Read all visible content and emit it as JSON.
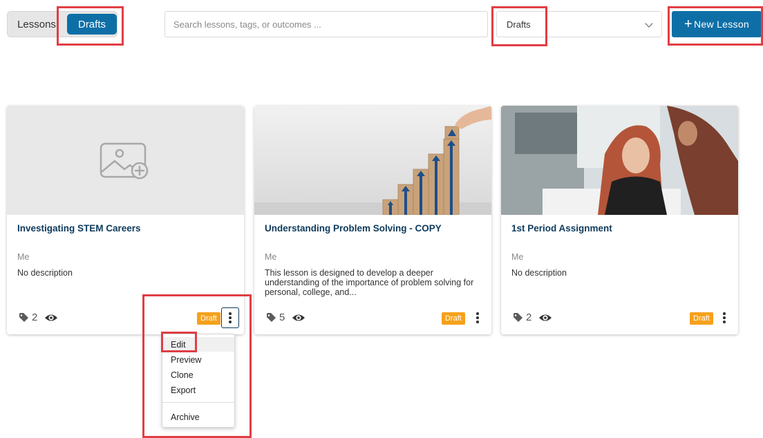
{
  "tabs": {
    "lessons_label": "Lessons",
    "drafts_label": "Drafts"
  },
  "search": {
    "placeholder": "Search lessons, tags, or outcomes ..."
  },
  "filter": {
    "selected": "Drafts"
  },
  "new_lesson": {
    "icon": "+",
    "label": "New Lesson"
  },
  "colors": {
    "primary": "#0e6fa7",
    "badge": "#f5a11c",
    "highlight": "#e03e45",
    "title": "#0d3a5c"
  },
  "cards": [
    {
      "title": "Investigating STEM Careers",
      "author": "Me",
      "description": "No description",
      "tags_count": "2",
      "badge": "Draft",
      "image": "image-placeholder-icon"
    },
    {
      "title": "Understanding Problem Solving - COPY",
      "author": "Me",
      "description": "This lesson is designed to develop a deeper understanding of the importance of problem solving for personal, college, and...",
      "tags_count": "5",
      "badge": "Draft",
      "image": "growth-blocks-photo"
    },
    {
      "title": "1st Period Assignment",
      "author": "Me",
      "description": "No description",
      "tags_count": "2",
      "badge": "Draft",
      "image": "classroom-students-photo"
    }
  ],
  "context_menu": {
    "items": [
      "Edit",
      "Preview",
      "Clone",
      "Export",
      "Archive"
    ]
  }
}
